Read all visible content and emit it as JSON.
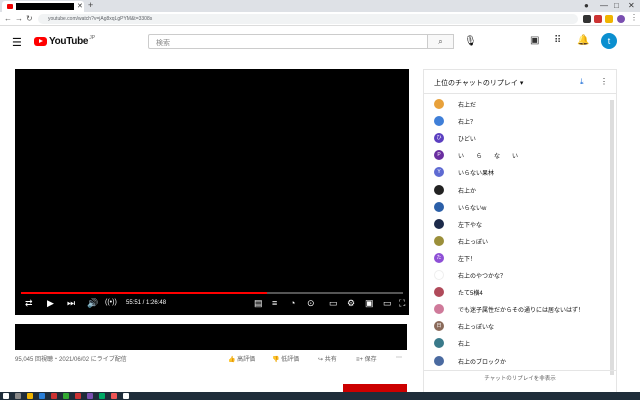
{
  "browser": {
    "url": "youtube.com/watch?v=jAg8xqLgPYM&t=3308s",
    "new_tab_label": "+"
  },
  "youtube": {
    "logo_text": "YouTube",
    "region": "JP",
    "search_placeholder": "検索",
    "avatar_letter": "t"
  },
  "player": {
    "time": "55:51 / 1:26:48",
    "progress": 0.643
  },
  "video": {
    "stats": "95,045 回視聴・2021/06/02 にライブ配信",
    "like_label": "高評価",
    "dislike_label": "低評価",
    "share_label": "共有",
    "save_label": "保存"
  },
  "chat": {
    "title": "上位のチャットのリプレイ ▾",
    "footer": "チャットのリプレイを非表示",
    "messages": [
      {
        "text": "右上だ",
        "color": "#e8a13a",
        "initial": ""
      },
      {
        "text": "右上？",
        "color": "#3f7fd8",
        "initial": ""
      },
      {
        "text": "ひどい",
        "color": "#5b3fc0",
        "initial": "ひ"
      },
      {
        "text": "い　　ら　　な　　い",
        "color": "#6a2ea0",
        "initial": "P"
      },
      {
        "text": "いらない果林",
        "color": "#5e6ad2",
        "initial": "Y"
      },
      {
        "text": "右上か",
        "color": "#222222",
        "initial": ""
      },
      {
        "text": "いらないw",
        "color": "#2b5fa8",
        "initial": ""
      },
      {
        "text": "左下やな",
        "color": "#1c2a4a",
        "initial": ""
      },
      {
        "text": "右上っぽい",
        "color": "#9b8f3a",
        "initial": ""
      },
      {
        "text": "左下！",
        "color": "#8e4fd6",
        "initial": "た"
      },
      {
        "text": "右上のやつかな？",
        "color": "#ffffff",
        "initial": ""
      },
      {
        "text": "たて5横4",
        "color": "#b04a5a",
        "initial": ""
      },
      {
        "text": "でも迷子属性だからその通りには居ないはず！",
        "color": "#cf7a9a",
        "initial": ""
      },
      {
        "text": "右上っぽいな",
        "color": "#8a6a5a",
        "initial": "日"
      },
      {
        "text": "右上",
        "color": "#3a7a8a",
        "initial": ""
      },
      {
        "text": "右上のブロックか",
        "color": "#4a6aa0",
        "initial": ""
      }
    ]
  }
}
